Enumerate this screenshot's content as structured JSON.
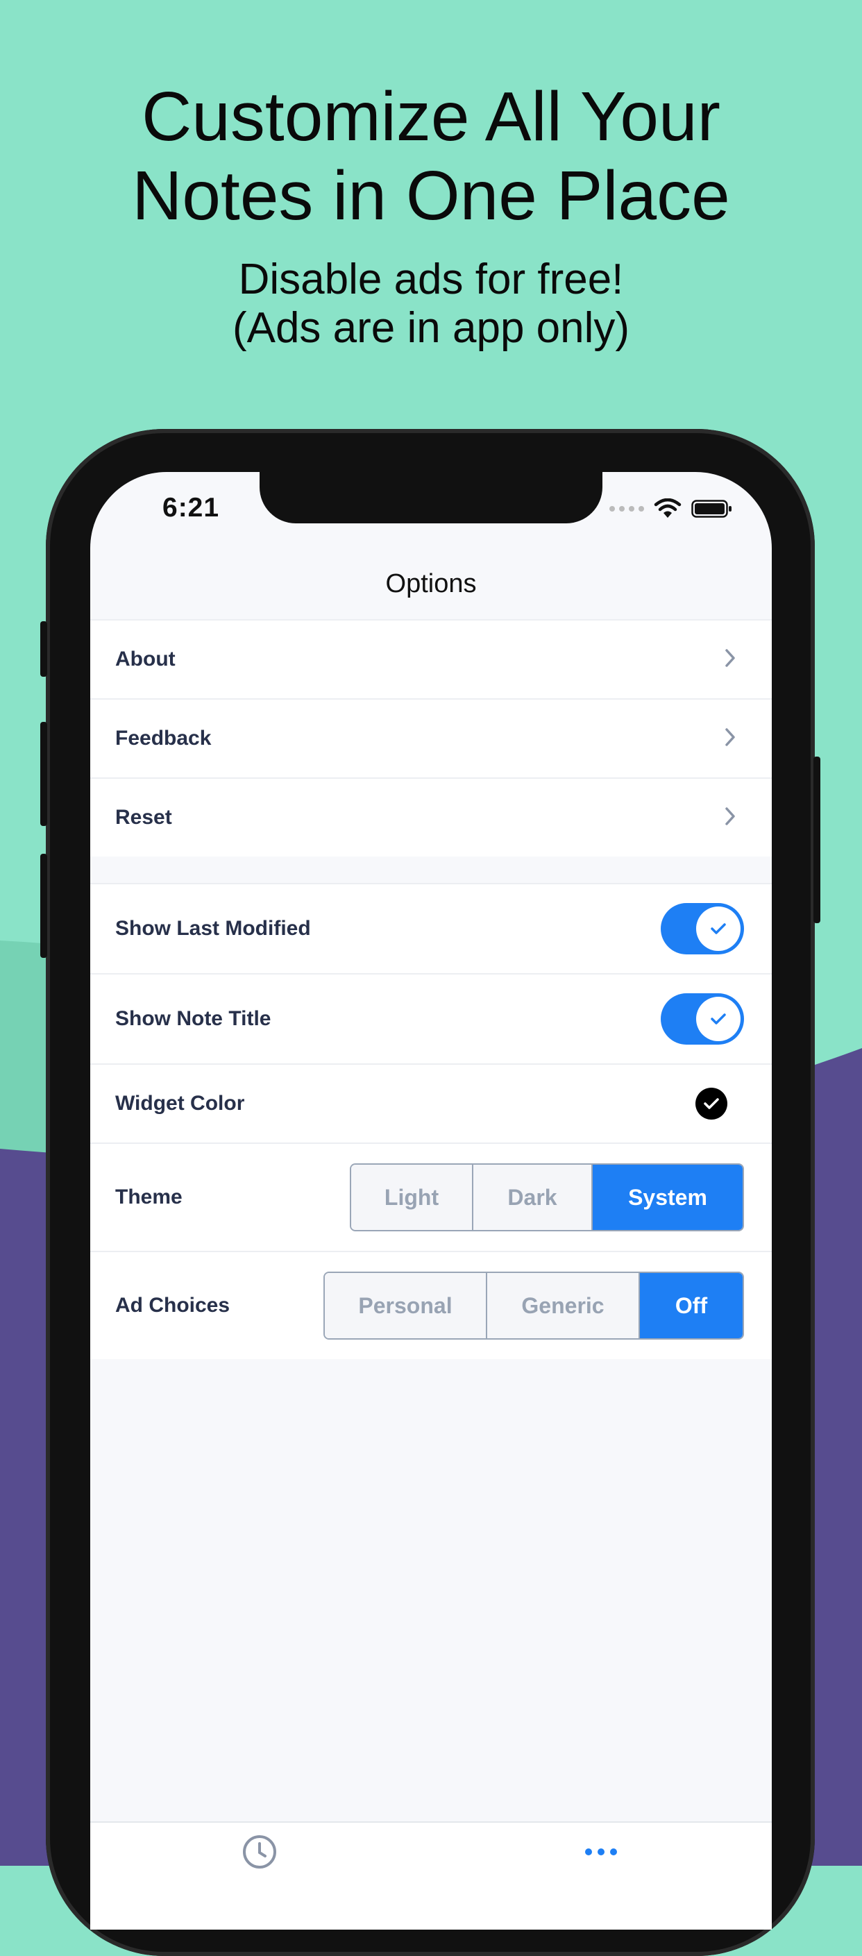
{
  "headline": {
    "line1": "Customize All Your",
    "line2": "Notes in One Place",
    "sub1": "Disable ads for free!",
    "sub2": "(Ads are in app only)"
  },
  "status_bar": {
    "time": "6:21"
  },
  "nav": {
    "title": "Options"
  },
  "menu": [
    {
      "label": "About",
      "icon": "chevron-right-icon"
    },
    {
      "label": "Feedback",
      "icon": "chevron-right-icon"
    },
    {
      "label": "Reset",
      "icon": "chevron-right-icon"
    }
  ],
  "settings": {
    "show_last_modified": {
      "label": "Show Last Modified",
      "on": true
    },
    "show_note_title": {
      "label": "Show Note Title",
      "on": true
    },
    "widget_color": {
      "label": "Widget Color",
      "color": "#000000"
    },
    "theme": {
      "label": "Theme",
      "options": [
        "Light",
        "Dark",
        "System"
      ],
      "selected": "System"
    },
    "ad_choices": {
      "label": "Ad Choices",
      "options": [
        "Personal",
        "Generic",
        "Off"
      ],
      "selected": "Off"
    }
  },
  "tabbar": {
    "items": [
      "clock-icon",
      "more-icon"
    ]
  },
  "colors": {
    "accent": "#1e7ff4",
    "background_mint": "#8ae3c8",
    "background_purple": "#574c8f"
  }
}
